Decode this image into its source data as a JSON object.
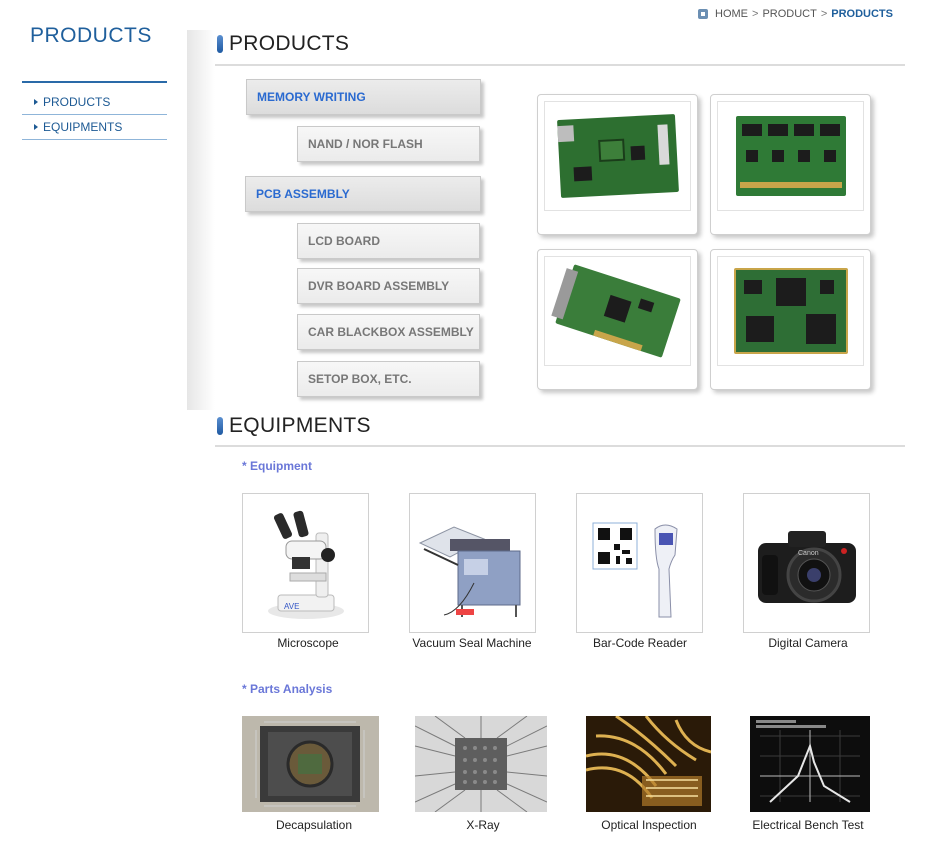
{
  "sidebar": {
    "title": "PRODUCTS",
    "items": [
      {
        "label": "PRODUCTS"
      },
      {
        "label": "EQUIPMENTS"
      }
    ]
  },
  "breadcrumb": {
    "home": "HOME",
    "product": "PRODUCT",
    "current": "PRODUCTS"
  },
  "sections": {
    "products": "PRODUCTS",
    "equipments": "EQUIPMENTS"
  },
  "menu": {
    "memory_writing": "MEMORY WRITING",
    "nand_nor": "NAND / NOR FLASH",
    "pcb_assembly": "PCB  ASSEMBLY",
    "lcd_board": "LCD BOARD",
    "dvr_board": "DVR  BOARD ASSEMBLY",
    "car_blackbox": "CAR BLACKBOX ASSEMBLY",
    "setop_box": "SETOP BOX, ETC."
  },
  "equipment": {
    "heading": "* Equipment",
    "items": [
      {
        "caption": "Microscope",
        "icon": "microscope-image"
      },
      {
        "caption": "Vacuum Seal Machine",
        "icon": "vacuum-seal-machine-image"
      },
      {
        "caption": "Bar-Code Reader",
        "icon": "barcode-reader-image"
      },
      {
        "caption": "Digital Camera",
        "icon": "digital-camera-image"
      }
    ]
  },
  "parts_analysis": {
    "heading": "* Parts Analysis",
    "items": [
      {
        "caption": "Decapsulation",
        "icon": "decapsulation-image"
      },
      {
        "caption": "X-Ray",
        "icon": "xray-image"
      },
      {
        "caption": "Optical Inspection",
        "icon": "optical-inspection-image"
      },
      {
        "caption": "Electrical Bench Test",
        "icon": "electrical-bench-test-image"
      }
    ]
  },
  "colors": {
    "brand_blue": "#1f5f9c",
    "link_blue": "#2a6ad0",
    "subheading_purple": "#6a77d8",
    "pcb_green": "#2f6b34"
  }
}
